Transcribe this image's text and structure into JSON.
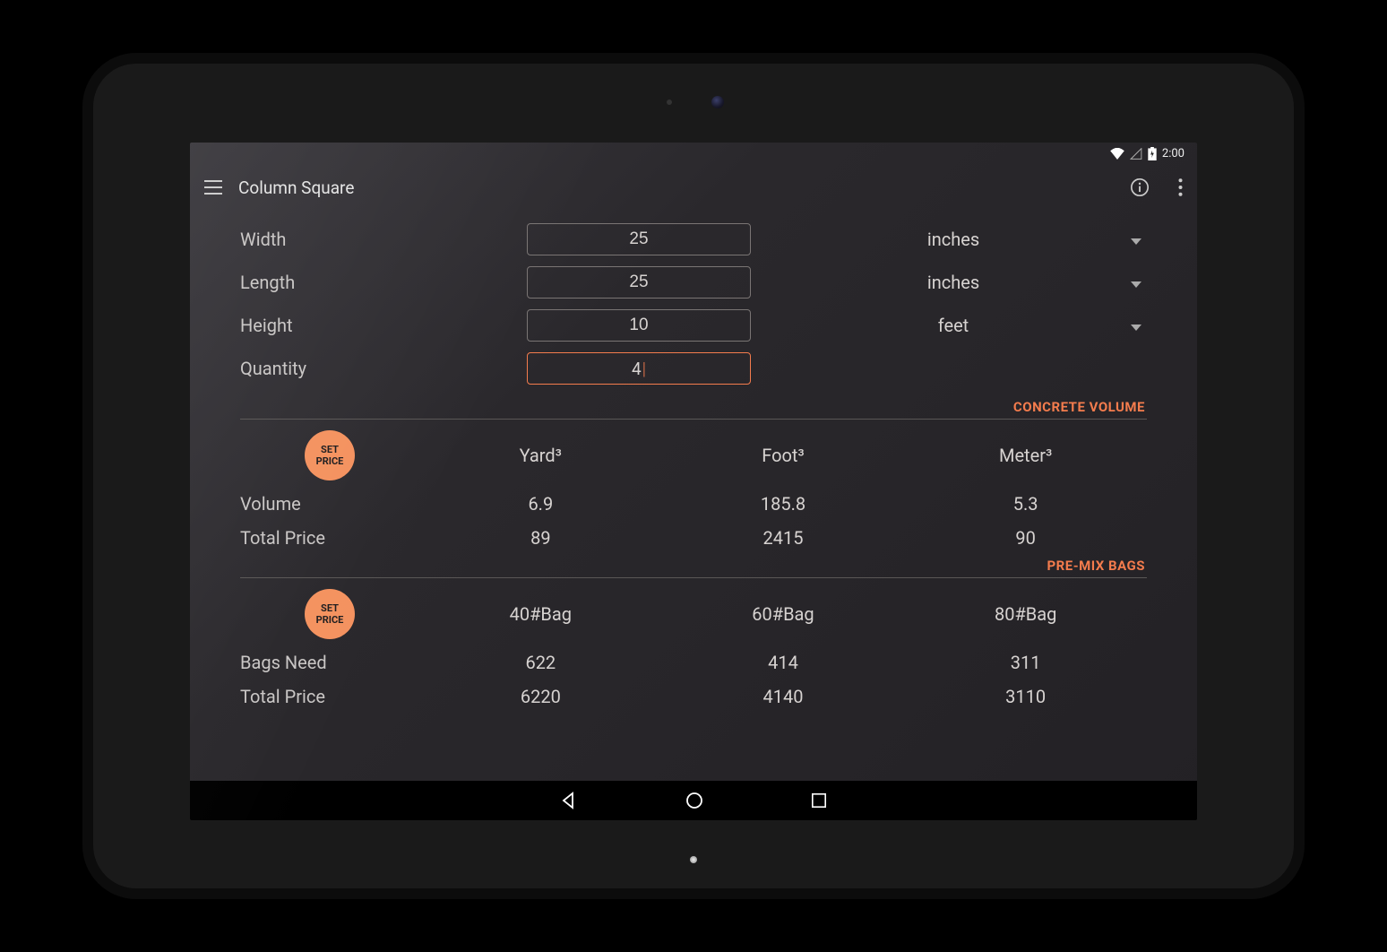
{
  "statusbar": {
    "time": "2:00"
  },
  "toolbar": {
    "title": "Column Square"
  },
  "inputs": {
    "width": {
      "label": "Width",
      "value": "25",
      "unit": "inches",
      "active": false
    },
    "length": {
      "label": "Length",
      "value": "25",
      "unit": "inches",
      "active": false
    },
    "height": {
      "label": "Height",
      "value": "10",
      "unit": "feet",
      "active": false
    },
    "quantity": {
      "label": "Quantity",
      "value": "4",
      "unit": null,
      "active": true
    }
  },
  "sections": {
    "volume": {
      "title": "CONCRETE VOLUME",
      "set_price_label_1": "SET",
      "set_price_label_2": "PRICE",
      "columns": [
        "Yard³",
        "Foot³",
        "Meter³"
      ],
      "rows": [
        {
          "label": "Volume",
          "values": [
            "6.9",
            "185.8",
            "5.3"
          ]
        },
        {
          "label": "Total Price",
          "values": [
            "89",
            "2415",
            "90"
          ]
        }
      ]
    },
    "bags": {
      "title": "PRE-MIX BAGS",
      "set_price_label_1": "SET",
      "set_price_label_2": "PRICE",
      "columns": [
        "40#Bag",
        "60#Bag",
        "80#Bag"
      ],
      "rows": [
        {
          "label": "Bags Need",
          "values": [
            "622",
            "414",
            "311"
          ]
        },
        {
          "label": "Total Price",
          "values": [
            "6220",
            "4140",
            "3110"
          ]
        }
      ]
    }
  },
  "accent": "#f47c4d"
}
